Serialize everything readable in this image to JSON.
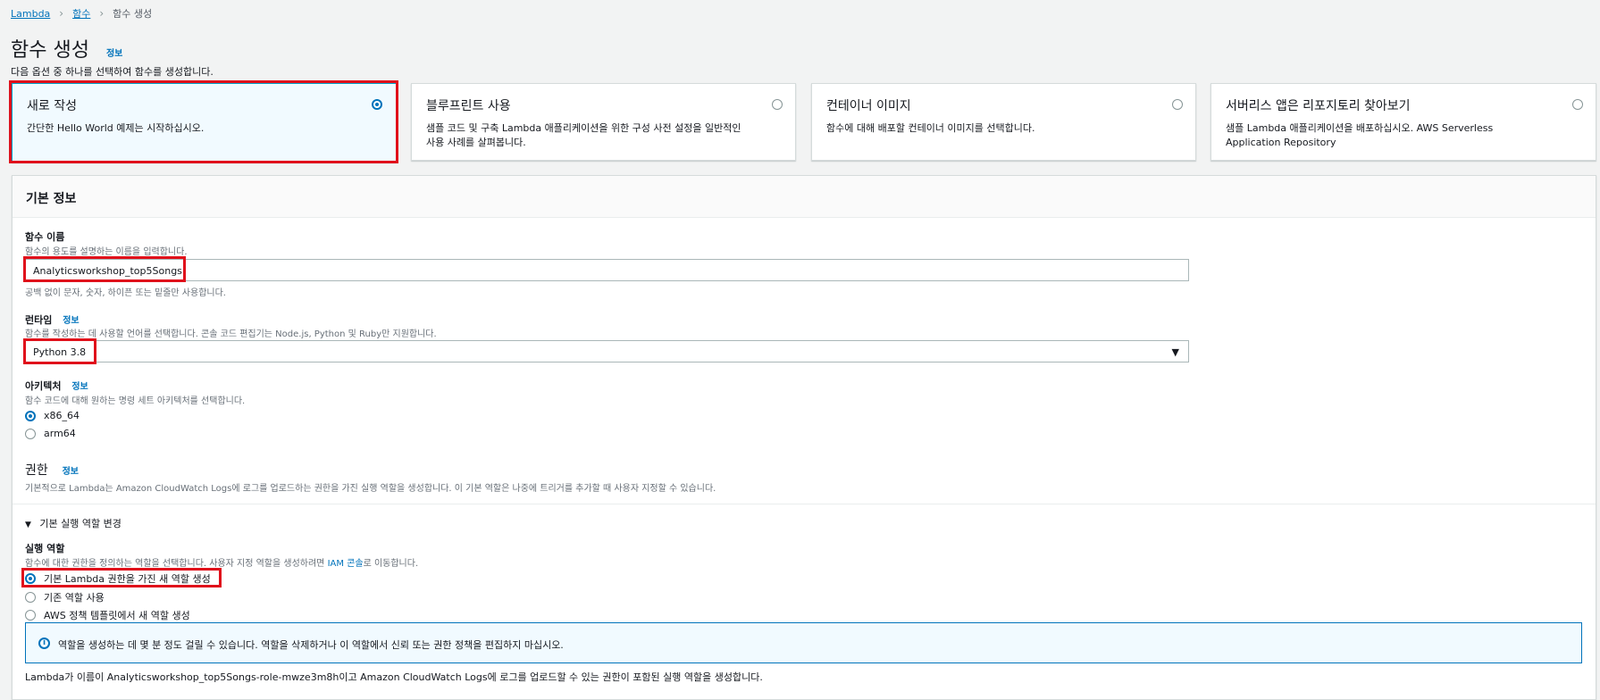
{
  "breadcrumb": {
    "lambda": "Lambda",
    "functions": "함수",
    "create": "함수 생성"
  },
  "page": {
    "title": "함수 생성",
    "info": "정보",
    "subtitle": "다음 옵션 중 하나를 선택하여 함수를 생성합니다."
  },
  "options": [
    {
      "title": "새로 작성",
      "desc": "간단한 Hello World 예제는 시작하십시오.",
      "selected": true
    },
    {
      "title": "블루프린트 사용",
      "desc": "샘플 코드 및 구축 Lambda 애플리케이션을 위한 구성 사전 설정을 일반적인 사용 사례를 살펴봅니다.",
      "selected": false
    },
    {
      "title": "컨테이너 이미지",
      "desc": "함수에 대해 배포할 컨테이너 이미지를 선택합니다.",
      "selected": false
    },
    {
      "title": "서버리스 앱은 리포지토리 찾아보기",
      "desc": "샘플 Lambda 애플리케이션을 배포하십시오. AWS Serverless Application Repository",
      "selected": false
    }
  ],
  "basic": {
    "header": "기본 정보",
    "fn_name_label": "함수 이름",
    "fn_name_hint": "함수의 용도를 설명하는 이름을 입력합니다.",
    "fn_name_value": "Analyticsworkshop_top5Songs",
    "fn_name_constraint": "공백 없이 문자, 숫자, 하이픈 또는 밑줄만 사용합니다.",
    "runtime_label": "런타임",
    "runtime_info": "정보",
    "runtime_hint": "함수를 작성하는 데 사용할 언어를 선택합니다. 콘솔 코드 편집기는 Node.js, Python 및 Ruby만 지원합니다.",
    "runtime_value": "Python 3.8",
    "arch_label": "아키텍처",
    "arch_info": "정보",
    "arch_hint": "함수 코드에 대해 원하는 명령 세트 아키텍처를 선택합니다.",
    "arch_options": [
      "x86_64",
      "arm64"
    ],
    "perm_title": "권한",
    "perm_info": "정보",
    "perm_desc": "기본적으로 Lambda는 Amazon CloudWatch Logs에 로그를 업로드하는 권한을 가진 실행 역할을 생성합니다. 이 기본 역할은 나중에 트리거를 추가할 때 사용자 지정할 수 있습니다.",
    "role_toggle": "기본 실행 역할 변경",
    "role_label": "실행 역할",
    "role_hint_prefix": "함수에 대한 권한을 정의하는 역할을 선택합니다. 사용자 지정 역할을 생성하려면 ",
    "role_hint_link": "IAM 콘솔",
    "role_hint_suffix": "로 이동합니다.",
    "role_options": [
      "기본 Lambda 권한을 가진 새 역할 생성",
      "기존 역할 사용",
      "AWS 정책 템플릿에서 새 역할 생성"
    ],
    "alert": "역할을 생성하는 데 몇 분 정도 걸릴 수 있습니다. 역할을 삭제하거나 이 역할에서 신뢰 또는 권한 정책을 편집하지 마십시오.",
    "footer": "Lambda가 이름이 Analyticsworkshop_top5Songs-role-mwze3m8h이고 Amazon CloudWatch Logs에 로그를 업로드할 수 있는 권한이 포함된 실행 역할을 생성합니다."
  }
}
